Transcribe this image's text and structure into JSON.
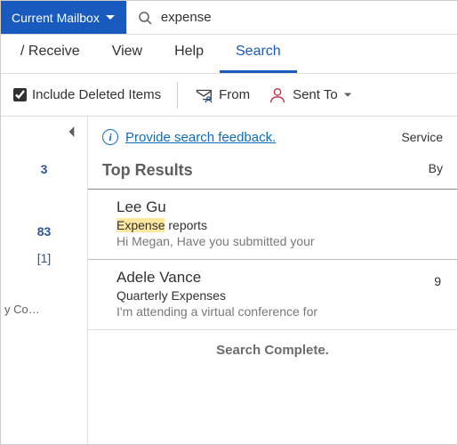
{
  "scope": {
    "label": "Current Mailbox"
  },
  "search": {
    "value": "expense",
    "placeholder": ""
  },
  "tabs": {
    "items": [
      {
        "label": "/ Receive"
      },
      {
        "label": "View"
      },
      {
        "label": "Help"
      },
      {
        "label": "Search",
        "active": true
      }
    ]
  },
  "ribbon": {
    "include_deleted": {
      "label": "Include Deleted Items",
      "checked": true
    },
    "from": {
      "label": "From"
    },
    "sent_to": {
      "label": "Sent To"
    }
  },
  "sidebar": {
    "count1": "3",
    "count2": "83",
    "count3": "[1]",
    "catlabel": "y Co…"
  },
  "feedback": {
    "link": "Provide search feedback.",
    "right": "Service"
  },
  "headers": {
    "top": "Top Results",
    "by": "By"
  },
  "results": [
    {
      "sender": "Lee Gu",
      "subject_hl": "Expense",
      "subject_rest": " reports",
      "preview": "Hi Megan,  Have you submitted your",
      "meta": ""
    },
    {
      "sender": "Adele Vance",
      "subject_hl": "",
      "subject_rest": "Quarterly Expenses",
      "preview": "I'm attending a virtual conference for",
      "meta": "9"
    }
  ],
  "footer": {
    "complete": "Search Complete."
  }
}
